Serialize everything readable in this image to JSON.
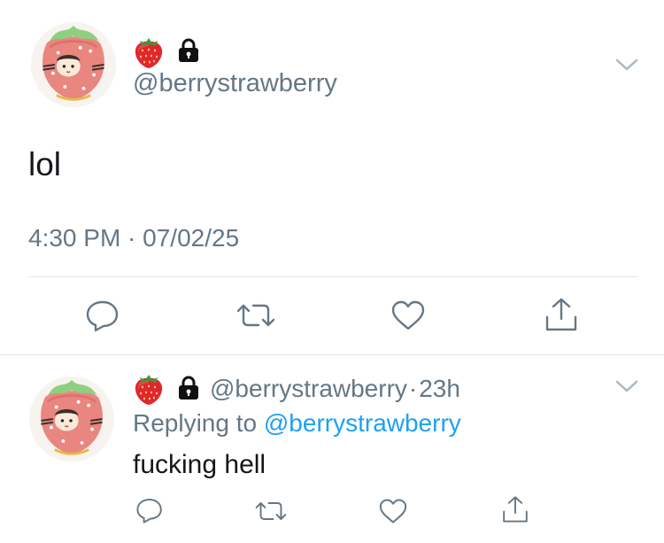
{
  "main_tweet": {
    "handle": "@berrystrawberry",
    "text": "lol",
    "timestamp": "4:30 PM · 07/02/25",
    "avatar": "strawberry-character-avatar",
    "badges": [
      "strawberry-emoji",
      "lock-icon"
    ]
  },
  "reply_tweet": {
    "handle": "@berrystrawberry",
    "separator": "·",
    "time_ago": "23h",
    "replying_prefix": "Replying to",
    "replying_to": "@berrystrawberry",
    "text": "fucking hell",
    "avatar": "strawberry-character-avatar",
    "badges": [
      "strawberry-emoji",
      "lock-icon"
    ]
  },
  "actions": [
    "reply-icon",
    "retweet-icon",
    "like-icon",
    "share-icon"
  ],
  "colors": {
    "text": "#14171a",
    "muted": "#657786",
    "link": "#1da1f2",
    "divider": "#e1e8ed"
  }
}
